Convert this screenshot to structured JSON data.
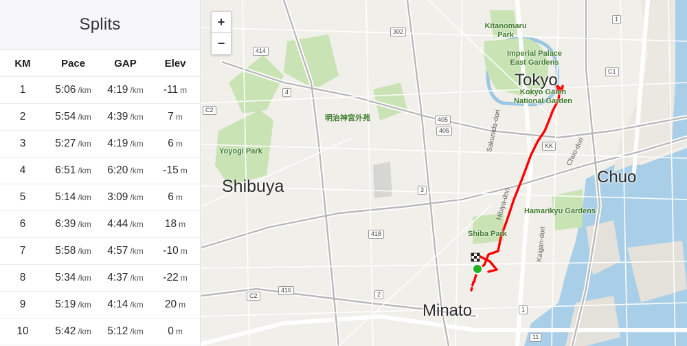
{
  "splits": {
    "title": "Splits",
    "columns": [
      "KM",
      "Pace",
      "GAP",
      "Elev"
    ],
    "rows": [
      {
        "km": "1",
        "pace": "5:06",
        "pace_unit": "/km",
        "gap": "4:19",
        "gap_unit": "/km",
        "elev": "-11",
        "elev_unit": "m"
      },
      {
        "km": "2",
        "pace": "5:54",
        "pace_unit": "/km",
        "gap": "4:39",
        "gap_unit": "/km",
        "elev": "7",
        "elev_unit": "m"
      },
      {
        "km": "3",
        "pace": "5:27",
        "pace_unit": "/km",
        "gap": "4:19",
        "gap_unit": "/km",
        "elev": "6",
        "elev_unit": "m"
      },
      {
        "km": "4",
        "pace": "6:51",
        "pace_unit": "/km",
        "gap": "6:20",
        "gap_unit": "/km",
        "elev": "-15",
        "elev_unit": "m"
      },
      {
        "km": "5",
        "pace": "5:14",
        "pace_unit": "/km",
        "gap": "3:09",
        "gap_unit": "/km",
        "elev": "6",
        "elev_unit": "m"
      },
      {
        "km": "6",
        "pace": "6:39",
        "pace_unit": "/km",
        "gap": "4:44",
        "gap_unit": "/km",
        "elev": "18",
        "elev_unit": "m"
      },
      {
        "km": "7",
        "pace": "5:58",
        "pace_unit": "/km",
        "gap": "4:57",
        "gap_unit": "/km",
        "elev": "-10",
        "elev_unit": "m"
      },
      {
        "km": "8",
        "pace": "5:34",
        "pace_unit": "/km",
        "gap": "4:37",
        "gap_unit": "/km",
        "elev": "-22",
        "elev_unit": "m"
      },
      {
        "km": "9",
        "pace": "5:19",
        "pace_unit": "/km",
        "gap": "4:14",
        "gap_unit": "/km",
        "elev": "20",
        "elev_unit": "m"
      },
      {
        "km": "10",
        "pace": "5:42",
        "pace_unit": "/km",
        "gap": "5:12",
        "gap_unit": "/km",
        "elev": "0",
        "elev_unit": "m"
      }
    ]
  },
  "map": {
    "zoom_in": "+",
    "zoom_out": "−",
    "route_color": "#ff0000",
    "start_marker_color": "#21b11f",
    "areas": [
      "Tokyo",
      "Shibuya",
      "Chuo",
      "Minato"
    ],
    "parks": [
      "Kitanomaru Park",
      "Imperial Palace East Gardens",
      "Kokyo Gaien National Garden",
      "Yoyogi Park",
      "Hamarikyu Gardens",
      "Shiba Park",
      "明治神宮外苑"
    ],
    "streets": [
      "Sakurada-dori",
      "Hibiya-dori",
      "Kaigan-dori",
      "Chuo-dori"
    ],
    "shields": [
      "1",
      "302",
      "414",
      "4",
      "C2",
      "405",
      "405",
      "KK",
      "3",
      "418",
      "416",
      "2",
      "C2",
      "C1",
      "11",
      "1"
    ]
  }
}
